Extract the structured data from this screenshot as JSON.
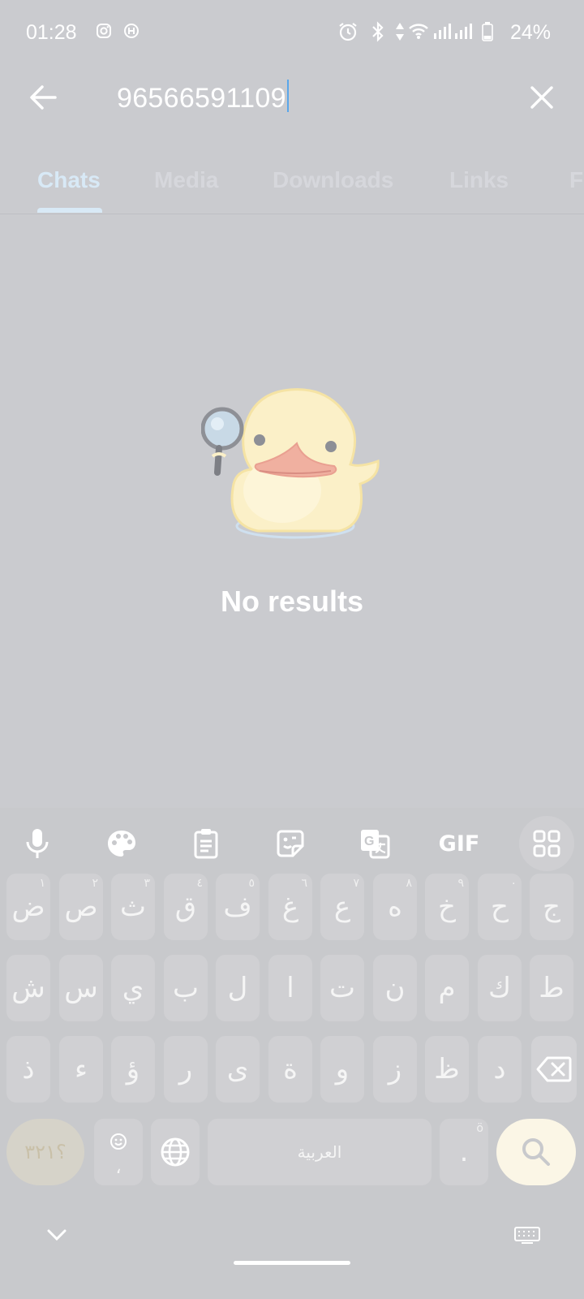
{
  "status_bar": {
    "time": "01:28",
    "battery": "24%",
    "icons": [
      "instagram-icon",
      "app-icon",
      "alarm-icon",
      "bluetooth-icon",
      "data-arrows-icon",
      "wifi-icon",
      "signal-icon",
      "signal-icon",
      "battery-icon"
    ]
  },
  "search": {
    "query": "96566591109"
  },
  "tabs": [
    {
      "label": "Chats",
      "active": true
    },
    {
      "label": "Media"
    },
    {
      "label": "Downloads"
    },
    {
      "label": "Links"
    },
    {
      "label": "Files"
    }
  ],
  "empty_state": {
    "title": "No results",
    "illustration": "duck-with-magnifier"
  },
  "keyboard": {
    "toolbar": [
      "mic-icon",
      "palette-icon",
      "clipboard-icon",
      "sticker-icon",
      "translate-icon",
      "GIF",
      "grid-icon"
    ],
    "gif_label": "GIF",
    "row1": [
      {
        "char": "ض",
        "hint": "١"
      },
      {
        "char": "ص",
        "hint": "٢"
      },
      {
        "char": "ث",
        "hint": "٣"
      },
      {
        "char": "ق",
        "hint": "٤"
      },
      {
        "char": "ف",
        "hint": "٥"
      },
      {
        "char": "غ",
        "hint": "٦"
      },
      {
        "char": "ع",
        "hint": "٧"
      },
      {
        "char": "ه",
        "hint": "٨"
      },
      {
        "char": "خ",
        "hint": "٩"
      },
      {
        "char": "ح",
        "hint": "٠"
      },
      {
        "char": "ج",
        "hint": ""
      }
    ],
    "row2": [
      "ش",
      "س",
      "ي",
      "ب",
      "ل",
      "ا",
      "ت",
      "ن",
      "م",
      "ك",
      "ط"
    ],
    "row3": [
      "ذ",
      "ء",
      "ؤ",
      "ر",
      "ى",
      "ة",
      "و",
      "ز",
      "ظ",
      "د"
    ],
    "symbols_label": "؟٣٢١",
    "comma": "،",
    "space_label": "العربية",
    "period": ".",
    "period_hint": "ö"
  },
  "colors": {
    "accent": "#5aa7ea",
    "background": "#cacbcf",
    "keyboard_bg": "#c8c9cc",
    "search_key": "#fbf6e6"
  }
}
